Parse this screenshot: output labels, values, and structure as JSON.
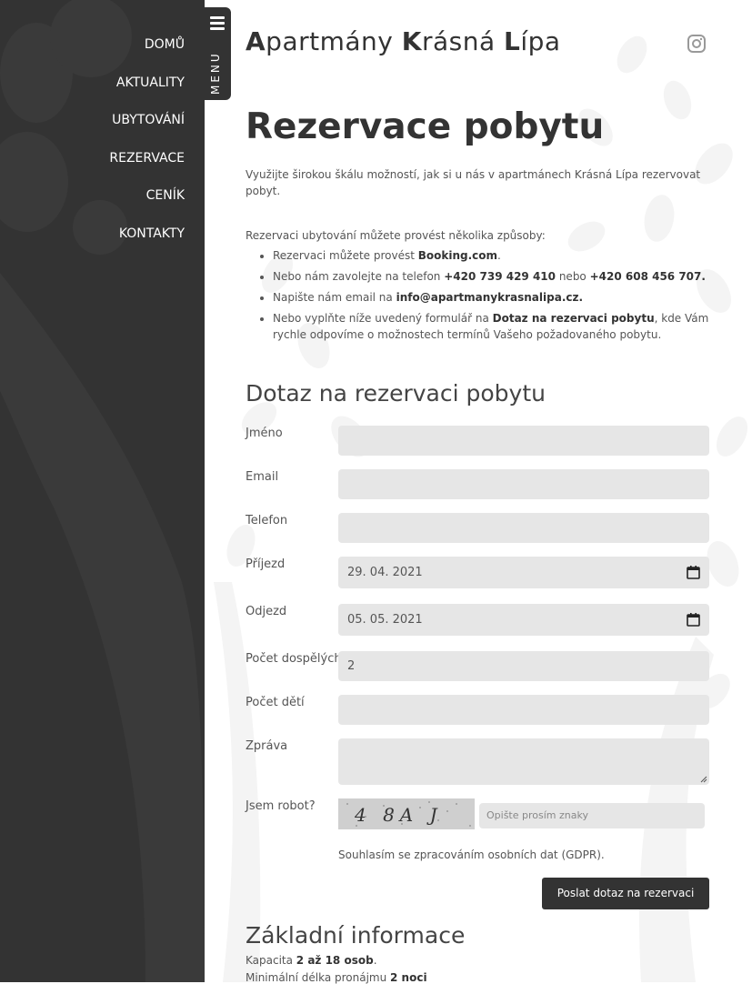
{
  "nav": {
    "items": [
      "DOMŮ",
      "AKTUALITY",
      "UBYTOVÁNÍ",
      "REZERVACE",
      "CENÍK",
      "KONTAKTY"
    ],
    "menu_label": "MENU"
  },
  "header": {
    "site_title_parts": [
      {
        "b": "A",
        "t": "partmány "
      },
      {
        "b": "K",
        "t": "rásná "
      },
      {
        "b": "L",
        "t": "ípa"
      }
    ]
  },
  "page": {
    "title": "Rezervace pobytu",
    "intro": "Využijte širokou škálu možností, jak si u nás v apartmánech Krásná Lípa rezervovat pobyt.",
    "ways_lead": "Rezervaci ubytování můžete provést několika způsoby:",
    "ways": [
      {
        "pre": "Rezervaci můžete provést ",
        "bold": "Booking.com",
        "post": "."
      },
      {
        "pre": "Nebo nám zavolejte na telefon ",
        "bold": "+420 739 429 410",
        "mid": " nebo ",
        "bold2": "+420 608 456 707."
      },
      {
        "pre": "Napište nám email na ",
        "bold": "info@apartmanykrasnalipa.cz."
      },
      {
        "pre": "Nebo vyplňte níže uvedený formulář na ",
        "bold": "Dotaz na rezervaci pobytu",
        "post": ", kde Vám rychle odpovíme o možnostech termínů Vašeho požadovaného pobytu."
      }
    ]
  },
  "form": {
    "title": "Dotaz na rezervaci pobytu",
    "labels": {
      "name": "Jméno",
      "email": "Email",
      "phone": "Telefon",
      "arrival": "Příjezd",
      "departure": "Odjezd",
      "adults": "Počet dospělých",
      "children": "Počet dětí",
      "message": "Zpráva",
      "robot": "Jsem robot?"
    },
    "values": {
      "name": "",
      "email": "",
      "phone": "",
      "arrival": "29. 04. 2021",
      "departure": "05. 05. 2021",
      "adults": "2",
      "children": "",
      "message": ""
    },
    "captcha_text": "4 8A J",
    "captcha_placeholder": "Opište prosím znaky",
    "gdpr": "Souhlasím se zpracováním osobních dat (GDPR).",
    "submit": "Poslat dotaz na rezervaci"
  },
  "info": {
    "title": "Základní informace",
    "capacity": {
      "pre": "Kapacita ",
      "bold": "2 až 18 osob",
      "post": "."
    },
    "min_stay": {
      "pre": "Minimální délka pronájmu ",
      "bold": "2 noci",
      "post": ""
    }
  },
  "colors": {
    "sidebar": "#333333",
    "field": "#e6e6e6",
    "button": "#333333"
  }
}
